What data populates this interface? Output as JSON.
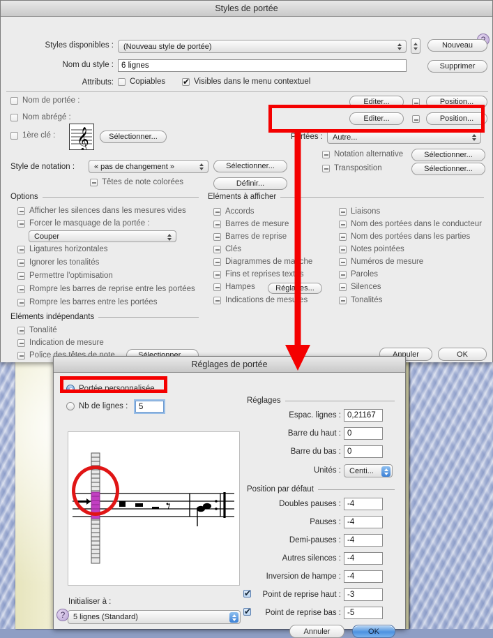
{
  "desktop": {
    "wallpaper": "blue-swirl",
    "page": "cream-paper-sheet"
  },
  "staff_styles_dialog": {
    "title": "Styles de portée",
    "help_label": "?",
    "available_styles": {
      "label": "Styles disponibles :",
      "value": "(Nouveau style de portée)"
    },
    "style_name": {
      "label": "Nom du style :",
      "value": "6 lignes"
    },
    "attributes": {
      "label": "Attributs:",
      "items": [
        {
          "label": "Copiables",
          "state": "unchecked"
        },
        {
          "label": "Visibles dans le menu contextuel",
          "state": "checked"
        }
      ]
    },
    "buttons": {
      "new": "Nouveau",
      "delete": "Supprimer",
      "cancel": "Annuler",
      "ok": "OK"
    },
    "name_rows": [
      {
        "label": "Nom de portée :",
        "state": "unchecked",
        "edit": "Editer...",
        "pos_state": "mixed",
        "position": "Position..."
      },
      {
        "label": "Nom abrégé :",
        "state": "unchecked",
        "edit": "Editer...",
        "pos_state": "mixed",
        "position": "Position..."
      }
    ],
    "first_clef": {
      "label": "1ère clé :",
      "state": "unchecked",
      "button": "Sélectionner..."
    },
    "staves": {
      "label": "Portées :",
      "value": "Autre..."
    },
    "alt_notation": {
      "label": "Notation alternative",
      "state": "mixed",
      "button": "Sélectionner..."
    },
    "transposition": {
      "label": "Transposition",
      "state": "mixed",
      "button": "Sélectionner..."
    },
    "notation_style": {
      "label": "Style de notation :",
      "value": "« pas de changement »",
      "button": "Sélectionner..."
    },
    "colored_noteheads": {
      "label": "Têtes de note colorées",
      "state": "mixed",
      "button": "Définir..."
    },
    "options": {
      "title": "Options",
      "items": [
        {
          "label": "Afficher les silences dans les mesures vides",
          "state": "mixed"
        },
        {
          "label": "Forcer le masquage de la portée :",
          "state": "mixed"
        },
        {
          "label": "Ligatures horizontales",
          "state": "mixed"
        },
        {
          "label": "Ignorer les tonalités",
          "state": "mixed"
        },
        {
          "label": "Permettre l'optimisation",
          "state": "mixed"
        },
        {
          "label": "Rompre les barres de reprise entre les portées",
          "state": "mixed"
        },
        {
          "label": "Rompre les barres entre les portées",
          "state": "mixed"
        }
      ],
      "hide_mode": "Couper"
    },
    "independent": {
      "title": "Eléments indépendants",
      "items": [
        {
          "label": "Tonalité",
          "state": "mixed"
        },
        {
          "label": "Indication de mesure",
          "state": "mixed"
        },
        {
          "label": "Police des têtes de note",
          "state": "mixed",
          "button": "Sélectionner..."
        }
      ]
    },
    "display_elements": {
      "title": "Eléments à afficher",
      "col1": [
        {
          "label": "Accords",
          "state": "mixed"
        },
        {
          "label": "Barres de mesure",
          "state": "mixed"
        },
        {
          "label": "Barres de reprise",
          "state": "mixed"
        },
        {
          "label": "Clés",
          "state": "mixed"
        },
        {
          "label": "Diagrammes de manche",
          "state": "mixed"
        },
        {
          "label": "Fins et reprises textes",
          "state": "mixed"
        },
        {
          "label": "Hampes",
          "state": "mixed",
          "button": "Réglages..."
        },
        {
          "label": "Indications de mesures",
          "state": "mixed"
        }
      ],
      "col2": [
        {
          "label": "Liaisons",
          "state": "mixed"
        },
        {
          "label": "Nom des portées dans le conducteur",
          "state": "mixed"
        },
        {
          "label": "Nom des portées dans les parties",
          "state": "mixed"
        },
        {
          "label": "Notes pointées",
          "state": "mixed"
        },
        {
          "label": "Numéros de mesure",
          "state": "mixed"
        },
        {
          "label": "Paroles",
          "state": "mixed"
        },
        {
          "label": "Silences",
          "state": "mixed"
        },
        {
          "label": "Tonalités",
          "state": "mixed"
        }
      ]
    }
  },
  "staff_setup_dialog": {
    "title": "Réglages de portée",
    "help_label": "?",
    "mode": {
      "custom": {
        "label": "Portée personnalisée",
        "selected": true
      },
      "numlines": {
        "label": "Nb de lignes :",
        "selected": false,
        "value": "5"
      }
    },
    "reset_to": {
      "label": "Initialiser à :",
      "value": "5 lignes (Standard)"
    },
    "settings": {
      "title": "Réglages",
      "fields": [
        {
          "label": "Espac. lignes :",
          "value": "0,21167"
        },
        {
          "label": "Barre du haut :",
          "value": "0"
        },
        {
          "label": "Barre du bas :",
          "value": "0"
        }
      ],
      "units": {
        "label": "Unités :",
        "value": "Centi..."
      }
    },
    "default_position": {
      "title": "Position par défaut",
      "fields": [
        {
          "label": "Doubles pauses :",
          "value": "-4",
          "checkbox": null
        },
        {
          "label": "Pauses :",
          "value": "-4",
          "checkbox": null
        },
        {
          "label": "Demi-pauses :",
          "value": "-4",
          "checkbox": null
        },
        {
          "label": "Autres silences :",
          "value": "-4",
          "checkbox": null
        },
        {
          "label": "Inversion de hampe :",
          "value": "-4",
          "checkbox": null
        },
        {
          "label": "Point de reprise haut :",
          "value": "-3",
          "checkbox": "checked"
        },
        {
          "label": "Point de reprise bas :",
          "value": "-5",
          "checkbox": "checked"
        }
      ]
    },
    "buttons": {
      "cancel": "Annuler",
      "ok": "OK"
    },
    "preview": {
      "name": "staff-preview",
      "custom_line_color": "#c23fc2",
      "description": "Portée personnalisée avec colonne de lignes sélectionnables"
    }
  },
  "annotations": {
    "highlight_color": "#f40000",
    "rect_staves": "Portées : Autre...",
    "rect_custom_staff": "Portée personnalisée",
    "circle_preview": "colonne de lignes de portée",
    "arrow": "vers Réglages de portée"
  }
}
